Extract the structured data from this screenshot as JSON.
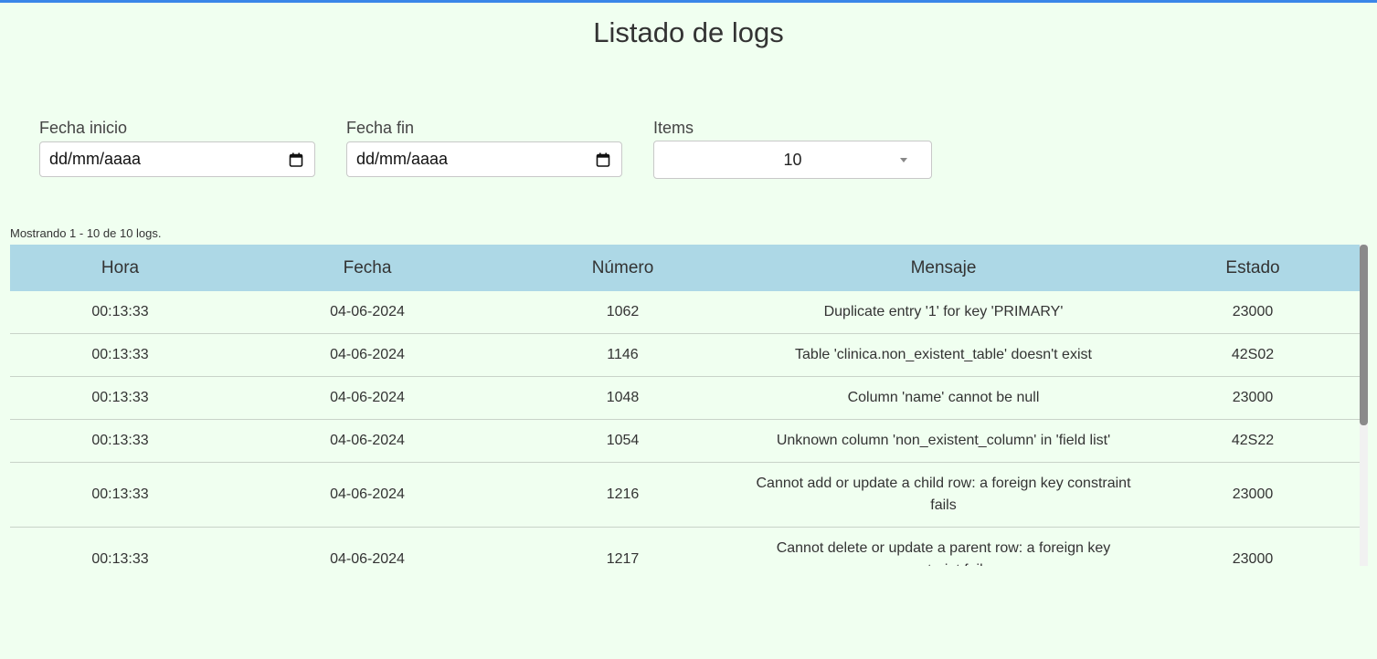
{
  "page": {
    "title": "Listado de logs"
  },
  "filters": {
    "fecha_inicio": {
      "label": "Fecha inicio",
      "value": "dd/mm/aaaa"
    },
    "fecha_fin": {
      "label": "Fecha fin",
      "value": "dd/mm/aaaa"
    },
    "items": {
      "label": "Items",
      "value": "10"
    }
  },
  "summary": "Mostrando 1 - 10 de 10 logs.",
  "table": {
    "headers": [
      "Hora",
      "Fecha",
      "Número",
      "Mensaje",
      "Estado"
    ],
    "rows": [
      [
        "00:13:33",
        "04-06-2024",
        "1062",
        "Duplicate entry '1' for key 'PRIMARY'",
        "23000"
      ],
      [
        "00:13:33",
        "04-06-2024",
        "1146",
        "Table 'clinica.non_existent_table' doesn't exist",
        "42S02"
      ],
      [
        "00:13:33",
        "04-06-2024",
        "1048",
        "Column 'name' cannot be null",
        "23000"
      ],
      [
        "00:13:33",
        "04-06-2024",
        "1054",
        "Unknown column 'non_existent_column' in 'field list'",
        "42S22"
      ],
      [
        "00:13:33",
        "04-06-2024",
        "1216",
        "Cannot add or update a child row: a foreign key constraint fails",
        "23000"
      ],
      [
        "00:13:33",
        "04-06-2024",
        "1217",
        "Cannot delete or update a parent row: a foreign key constraint fails",
        "23000"
      ]
    ]
  },
  "colors": {
    "accent": "#3a86e8",
    "header_bg": "#add8e6",
    "page_bg": "#f0fff0"
  },
  "icons": {
    "date": "calendar-icon",
    "select": "chevron-down-icon"
  }
}
